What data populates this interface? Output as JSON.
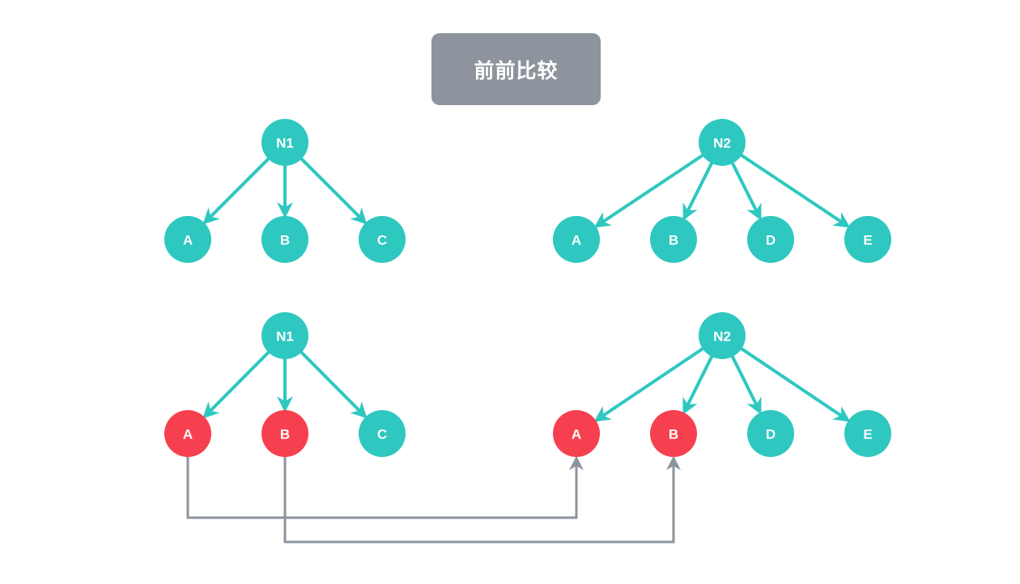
{
  "title": "前前比较",
  "colors": {
    "node_default": "#2ec8c0",
    "node_matched": "#f7404f",
    "edge": "#2ec8c0",
    "link": "#8e949d",
    "title_bg": "#8e949d"
  },
  "trees": {
    "top_left": {
      "root": "N1",
      "children": [
        {
          "label": "A",
          "state": "default"
        },
        {
          "label": "B",
          "state": "default"
        },
        {
          "label": "C",
          "state": "default"
        }
      ]
    },
    "top_right": {
      "root": "N2",
      "children": [
        {
          "label": "A",
          "state": "default"
        },
        {
          "label": "B",
          "state": "default"
        },
        {
          "label": "D",
          "state": "default"
        },
        {
          "label": "E",
          "state": "default"
        }
      ]
    },
    "bottom_left": {
      "root": "N1",
      "children": [
        {
          "label": "A",
          "state": "matched"
        },
        {
          "label": "B",
          "state": "matched"
        },
        {
          "label": "C",
          "state": "default"
        }
      ]
    },
    "bottom_right": {
      "root": "N2",
      "children": [
        {
          "label": "A",
          "state": "matched"
        },
        {
          "label": "B",
          "state": "matched"
        },
        {
          "label": "D",
          "state": "default"
        },
        {
          "label": "E",
          "state": "default"
        }
      ]
    }
  },
  "links": [
    {
      "from": "bottom_left.A",
      "to": "bottom_right.A"
    },
    {
      "from": "bottom_left.B",
      "to": "bottom_right.B"
    }
  ]
}
